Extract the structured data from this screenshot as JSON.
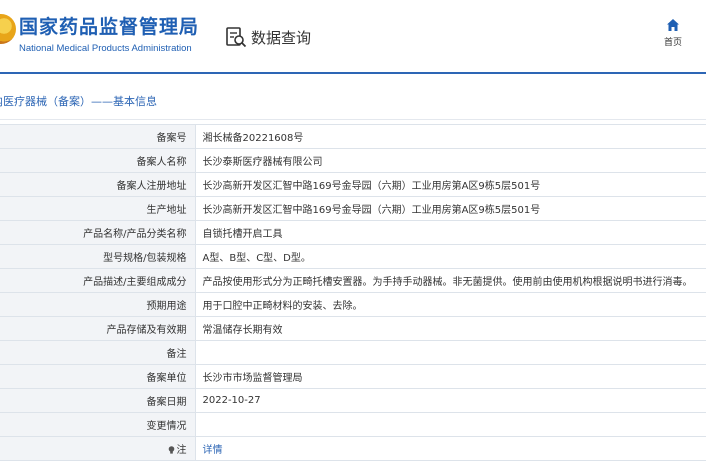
{
  "header": {
    "site_name_cn": "国家药品监督管理局",
    "site_name_en": "National Medical Products Administration",
    "page_title": "数据查询",
    "home_label": "首页",
    "accent_color": "#2d66b5"
  },
  "section": {
    "title": "内医疗器械（备案）——基本信息"
  },
  "rows": [
    {
      "key": "备案号",
      "value": "湘长械备20221608号"
    },
    {
      "key": "备案人名称",
      "value": "长沙泰斯医疗器械有限公司"
    },
    {
      "key": "备案人注册地址",
      "value": "长沙高新开发区汇智中路169号金导园（六期）工业用房第A区9栋5层501号"
    },
    {
      "key": "生产地址",
      "value": "长沙高新开发区汇智中路169号金导园（六期）工业用房第A区9栋5层501号"
    },
    {
      "key": "产品名称/产品分类名称",
      "value": "自锁托槽开启工具"
    },
    {
      "key": "型号规格/包装规格",
      "value": "A型、B型、C型、D型。"
    },
    {
      "key": "产品描述/主要组成成分",
      "value": "产品按使用形式分为正畸托槽安置器。为手持手动器械。非无菌提供。使用前由使用机构根据说明书进行消毒。"
    },
    {
      "key": "预期用途",
      "value": "用于口腔中正畸材料的安装、去除。"
    },
    {
      "key": "产品存储及有效期",
      "value": "常温储存长期有效"
    },
    {
      "key": "备注",
      "value": ""
    },
    {
      "key": "备案单位",
      "value": "长沙市市场监督管理局"
    },
    {
      "key": "备案日期",
      "value": "2022-10-27"
    },
    {
      "key": "变更情况",
      "value": ""
    }
  ],
  "note_row": {
    "key_suffix": "注",
    "link_label": "详情",
    "icon": "bulb-icon"
  }
}
